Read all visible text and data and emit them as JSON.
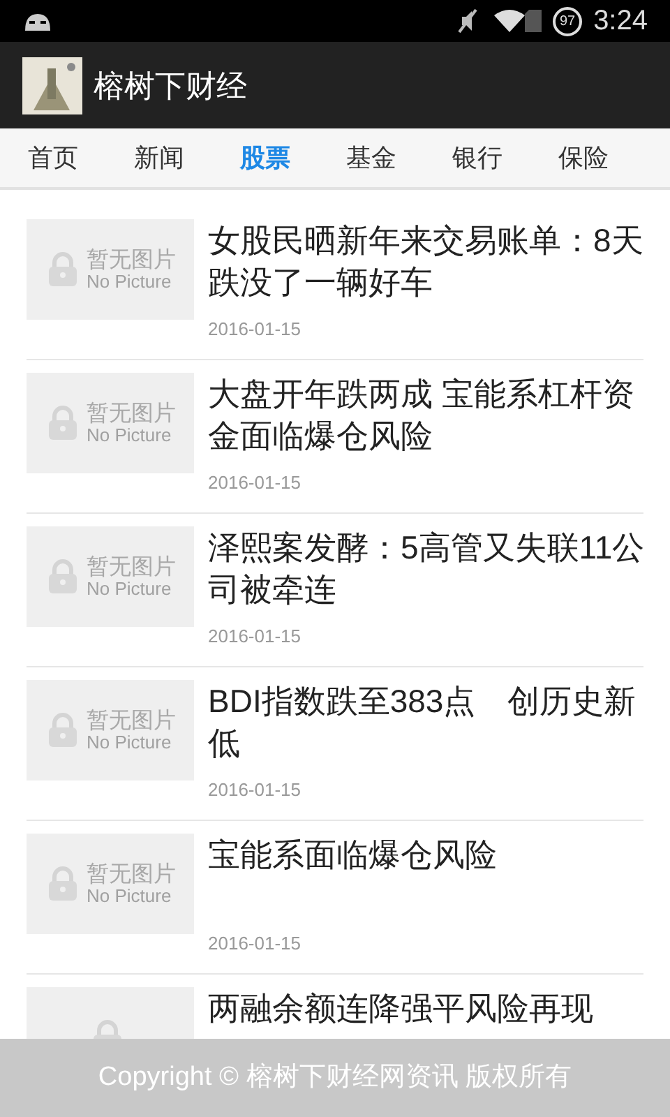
{
  "status_bar": {
    "battery": "97",
    "time": "3:24"
  },
  "app_bar": {
    "title": "榕树下财经"
  },
  "tabs": [
    {
      "label": "首页",
      "selected": false
    },
    {
      "label": "新闻",
      "selected": false
    },
    {
      "label": "股票",
      "selected": true
    },
    {
      "label": "基金",
      "selected": false
    },
    {
      "label": "银行",
      "selected": false
    },
    {
      "label": "保险",
      "selected": false
    }
  ],
  "articles": [
    {
      "title": "女股民晒新年来交易账单：8天跌没了一辆好车",
      "date": "2016-01-15",
      "thumb_label": "暂无图片",
      "thumb_sublabel": "No Picture"
    },
    {
      "title": "大盘开年跌两成 宝能系杠杆资金面临爆仓风险",
      "date": "2016-01-15",
      "thumb_label": "暂无图片",
      "thumb_sublabel": "No Picture"
    },
    {
      "title": "泽熙案发酵：5高管又失联11公司被牵连",
      "date": "2016-01-15",
      "thumb_label": "暂无图片",
      "thumb_sublabel": "No Picture"
    },
    {
      "title": "BDI指数跌至383点　创历史新低",
      "date": "2016-01-15",
      "thumb_label": "暂无图片",
      "thumb_sublabel": "No Picture"
    },
    {
      "title": "宝能系面临爆仓风险",
      "date": "2016-01-15",
      "thumb_label": "暂无图片",
      "thumb_sublabel": "No Picture"
    },
    {
      "title": "两融余额连降强平风险再现"
    }
  ],
  "footer": {
    "text": "Copyright © 榕树下财经网资讯 版权所有"
  }
}
